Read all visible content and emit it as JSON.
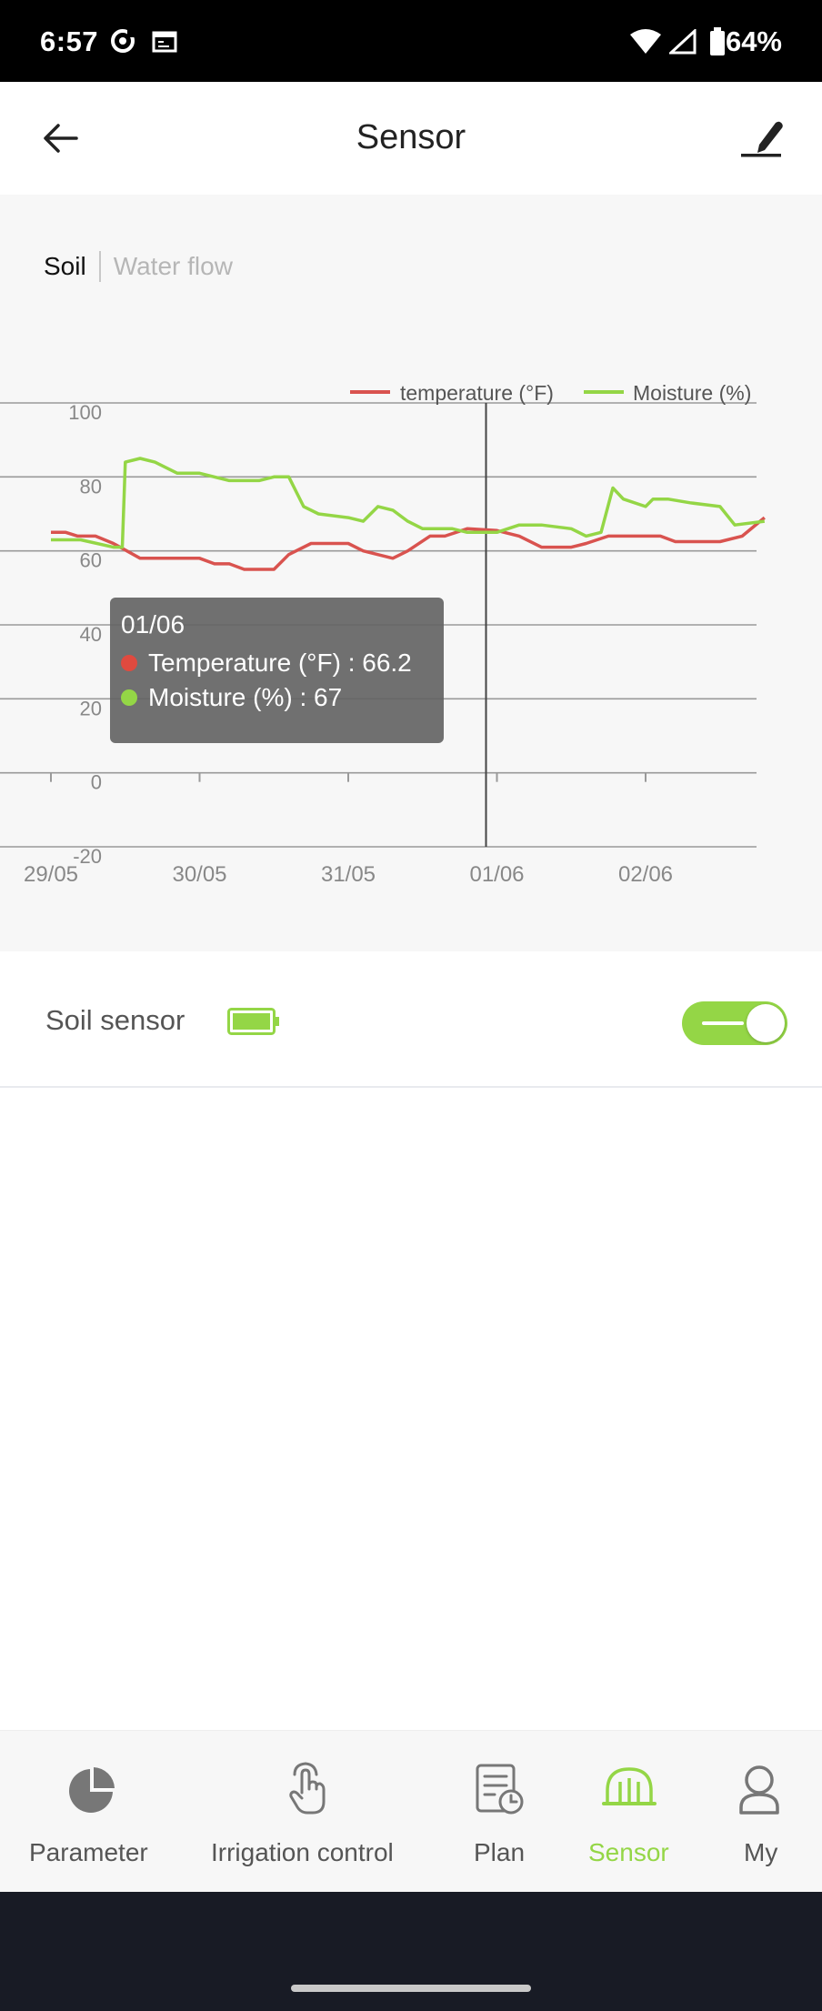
{
  "status_bar": {
    "time": "6:57",
    "battery": "64%"
  },
  "header": {
    "title": "Sensor"
  },
  "tabs": [
    {
      "label": "Soil",
      "active": true
    },
    {
      "label": "Water flow",
      "active": false
    }
  ],
  "chart_data": {
    "type": "line",
    "legend_position": "top-right",
    "grid": true,
    "ylim": [
      -20,
      100
    ],
    "yticks": [
      "100",
      "80",
      "60",
      "40",
      "20",
      "0",
      "-20"
    ],
    "xticks": [
      "29/05",
      "30/05",
      "31/05",
      "01/06",
      "02/06"
    ],
    "series": [
      {
        "name": "temperature (°F)",
        "color": "#d9534f",
        "points": [
          [
            0,
            65
          ],
          [
            0.1,
            65
          ],
          [
            0.18,
            64
          ],
          [
            0.3,
            64
          ],
          [
            0.42,
            62
          ],
          [
            0.6,
            58
          ],
          [
            0.8,
            58
          ],
          [
            1.0,
            58
          ],
          [
            1.1,
            56.5
          ],
          [
            1.2,
            56.5
          ],
          [
            1.3,
            55
          ],
          [
            1.5,
            55
          ],
          [
            1.6,
            59
          ],
          [
            1.75,
            62
          ],
          [
            2.0,
            62
          ],
          [
            2.1,
            60
          ],
          [
            2.3,
            58
          ],
          [
            2.4,
            60
          ],
          [
            2.55,
            64
          ],
          [
            2.65,
            64
          ],
          [
            2.8,
            66
          ],
          [
            3.0,
            65.5
          ],
          [
            3.15,
            64
          ],
          [
            3.3,
            61
          ],
          [
            3.5,
            61
          ],
          [
            3.6,
            62
          ],
          [
            3.75,
            64
          ],
          [
            4.0,
            64
          ],
          [
            4.1,
            64
          ],
          [
            4.2,
            62.5
          ],
          [
            4.5,
            62.5
          ],
          [
            4.65,
            64
          ],
          [
            4.8,
            69
          ]
        ]
      },
      {
        "name": "Moisture (%)",
        "color": "#94d646",
        "points": [
          [
            0,
            63
          ],
          [
            0.2,
            63
          ],
          [
            0.42,
            61
          ],
          [
            0.48,
            61
          ],
          [
            0.5,
            84
          ],
          [
            0.6,
            85
          ],
          [
            0.7,
            84
          ],
          [
            0.85,
            81
          ],
          [
            1.0,
            81
          ],
          [
            1.2,
            79
          ],
          [
            1.4,
            79
          ],
          [
            1.5,
            80
          ],
          [
            1.6,
            80
          ],
          [
            1.7,
            72
          ],
          [
            1.8,
            70
          ],
          [
            2.0,
            69
          ],
          [
            2.1,
            68
          ],
          [
            2.2,
            72
          ],
          [
            2.3,
            71
          ],
          [
            2.4,
            68
          ],
          [
            2.5,
            66
          ],
          [
            2.7,
            66
          ],
          [
            2.8,
            65
          ],
          [
            3.0,
            65
          ],
          [
            3.15,
            67
          ],
          [
            3.3,
            67
          ],
          [
            3.5,
            66
          ],
          [
            3.6,
            64
          ],
          [
            3.7,
            65
          ],
          [
            3.78,
            77
          ],
          [
            3.85,
            74
          ],
          [
            4.0,
            72
          ],
          [
            4.05,
            74
          ],
          [
            4.15,
            74
          ],
          [
            4.3,
            73
          ],
          [
            4.5,
            72
          ],
          [
            4.6,
            67
          ],
          [
            4.8,
            68
          ]
        ]
      }
    ],
    "cursor_x": 3.0
  },
  "tooltip": {
    "date": "01/06",
    "rows": [
      {
        "text": "Temperature (°F) : 66.2",
        "color": "#e04a3f"
      },
      {
        "text": "Moisture (%) : 67",
        "color": "#94d646"
      }
    ]
  },
  "sensor": {
    "label": "Soil sensor",
    "battery_icon": "battery-full-icon",
    "enabled": true
  },
  "bottom_nav": [
    {
      "label": "Parameter",
      "icon": "pie-chart-icon",
      "active": false
    },
    {
      "label": "Irrigation control",
      "icon": "hand-touch-icon",
      "active": false
    },
    {
      "label": "Plan",
      "icon": "schedule-icon",
      "active": false
    },
    {
      "label": "Sensor",
      "icon": "sensor-icon",
      "active": true
    },
    {
      "label": "My",
      "icon": "user-icon",
      "active": false
    }
  ],
  "colors": {
    "accent": "#94d646",
    "temperature": "#d9534f"
  }
}
